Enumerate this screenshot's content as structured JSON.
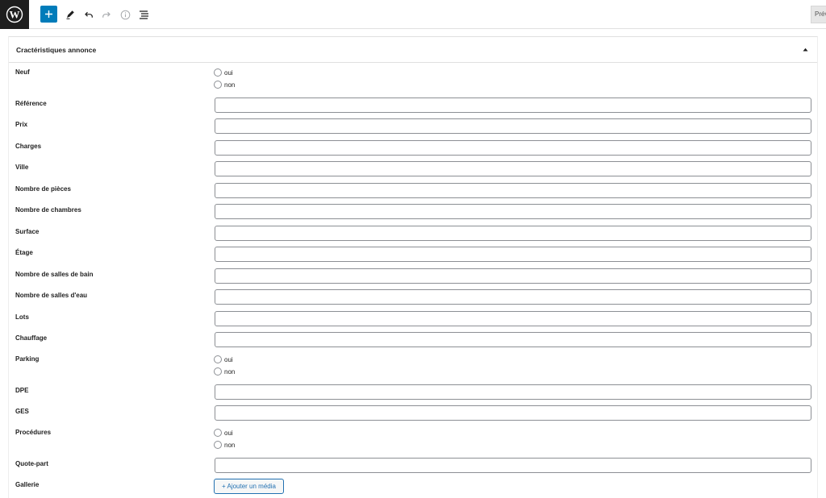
{
  "toolbar": {
    "icons": [
      "wordpress-logo",
      "plus-icon",
      "pencil-icon",
      "undo-icon",
      "redo-icon",
      "info-icon",
      "list-view-icon"
    ],
    "preview_label": "Prév",
    "accent": "#007cba"
  },
  "panel": {
    "title": "Cractéristiques annonce",
    "toggle_icon": "caret-up-icon"
  },
  "fields": {
    "neuf": {
      "label": "Neuf",
      "options": [
        "oui",
        "non"
      ]
    },
    "reference": {
      "label": "Référence",
      "value": ""
    },
    "prix": {
      "label": "Prix",
      "value": ""
    },
    "charges": {
      "label": "Charges",
      "value": ""
    },
    "ville": {
      "label": "Ville",
      "value": ""
    },
    "nombre_pieces": {
      "label": "Nombre de pièces",
      "value": ""
    },
    "nombre_chambres": {
      "label": "Nombre de chambres",
      "value": ""
    },
    "surface": {
      "label": "Surface",
      "value": ""
    },
    "etage": {
      "label": "Étage",
      "value": ""
    },
    "salles_bain": {
      "label": "Nombre de salles de bain",
      "value": ""
    },
    "salles_eau": {
      "label": "Nombre de salles d'eau",
      "value": ""
    },
    "lots": {
      "label": "Lots",
      "value": ""
    },
    "chauffage": {
      "label": "Chauffage",
      "value": ""
    },
    "parking": {
      "label": "Parking",
      "options": [
        "oui",
        "non"
      ]
    },
    "dpe": {
      "label": "DPE",
      "value": ""
    },
    "ges": {
      "label": "GES",
      "value": ""
    },
    "procedures": {
      "label": "Procédures",
      "options": [
        "oui",
        "non"
      ]
    },
    "quote_part": {
      "label": "Quote-part",
      "value": ""
    },
    "gallerie": {
      "label": "Gallerie",
      "button_label": "+ Ajouter un média"
    }
  }
}
